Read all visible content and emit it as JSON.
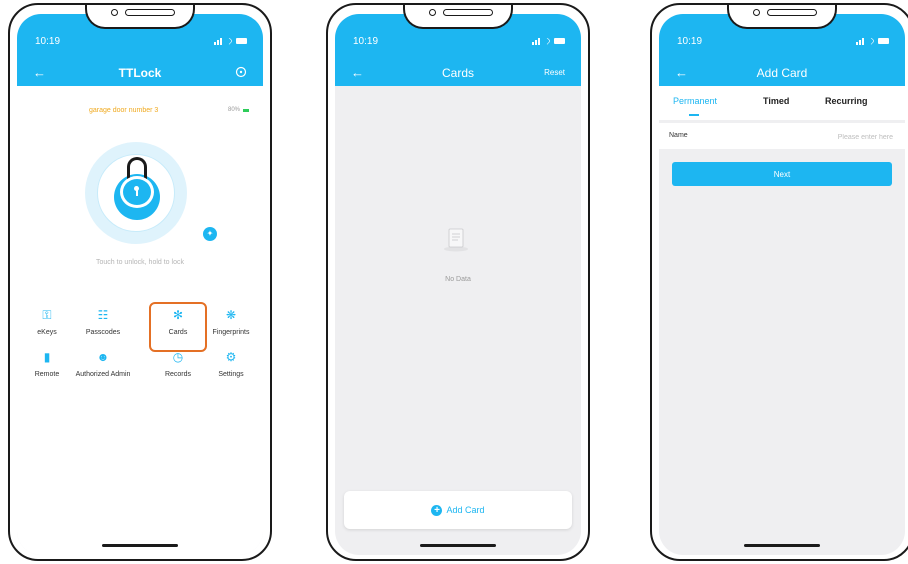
{
  "status": {
    "time": "10:19"
  },
  "phone1": {
    "title": "TTLock",
    "lock_name": "garage door number 3",
    "battery": "80%",
    "hint": "Touch to unlock, hold to lock",
    "menu": [
      {
        "label": "eKeys",
        "icon": "key-icon"
      },
      {
        "label": "Passcodes",
        "icon": "keypad-icon"
      },
      {
        "label": "Cards",
        "icon": "card-icon"
      },
      {
        "label": "Fingerprints",
        "icon": "fingerprint-icon"
      },
      {
        "label": "Remote",
        "icon": "remote-icon"
      },
      {
        "label": "Authorized Admin",
        "icon": "admin-icon"
      },
      {
        "label": "Records",
        "icon": "records-icon"
      },
      {
        "label": "Settings",
        "icon": "settings-icon"
      }
    ],
    "highlight_color": "#e47025"
  },
  "phone2": {
    "title": "Cards",
    "reset": "Reset",
    "empty": "No Data",
    "add_button": "Add Card"
  },
  "phone3": {
    "title": "Add Card",
    "tabs": [
      "Permanent",
      "Timed",
      "Recurring"
    ],
    "name_label": "Name",
    "name_placeholder": "Please enter here",
    "next_button": "Next"
  },
  "accent": "#1db6f1"
}
